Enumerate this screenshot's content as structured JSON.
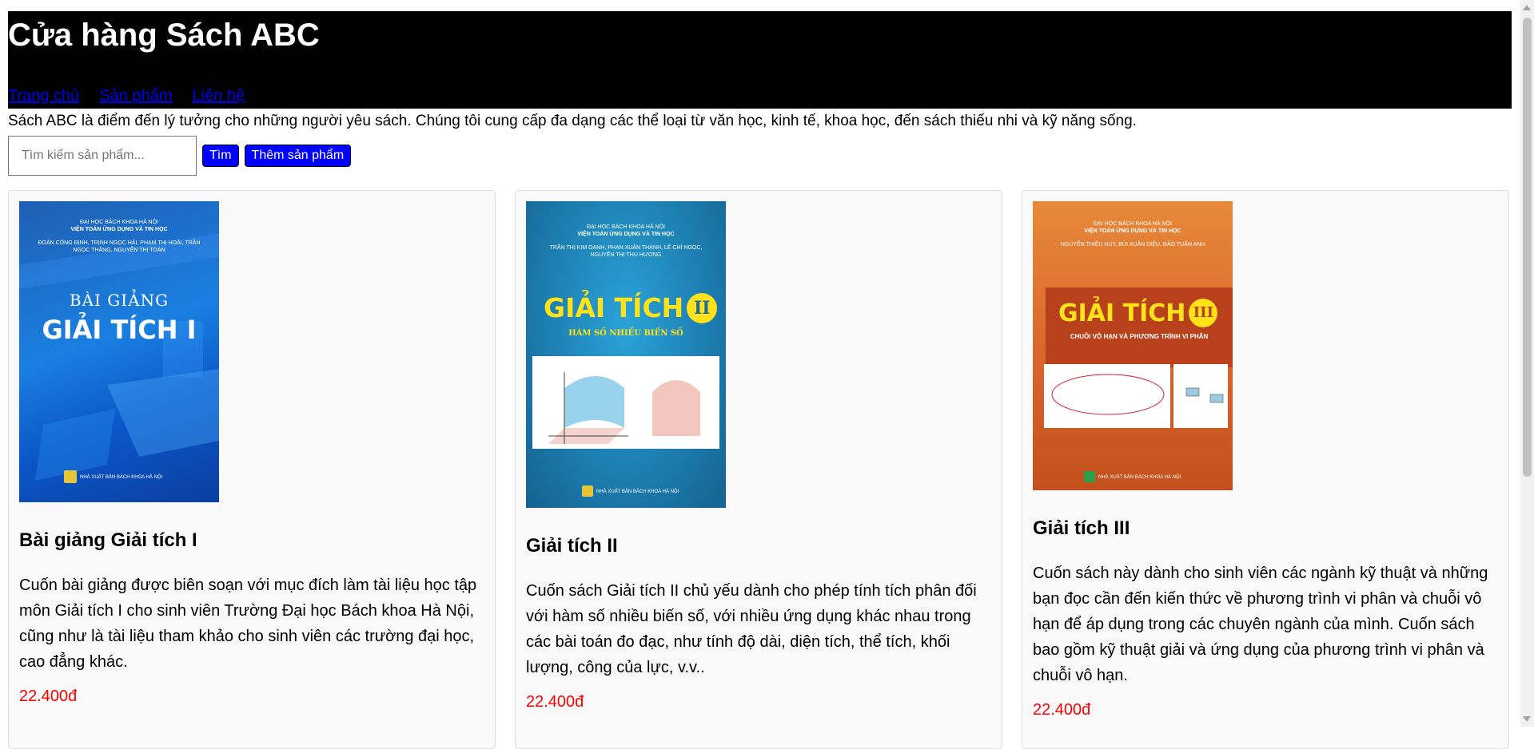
{
  "site": {
    "title": "Cửa hàng Sách ABC",
    "nav": [
      "Trang chủ",
      "Sản phẩm",
      "Liên hệ"
    ],
    "intro": "Sách ABC là điểm đến lý tưởng cho những người yêu sách. Chúng tôi cung cấp đa dạng các thể loại từ văn học, kinh tế, khoa học, đến sách thiếu nhi và kỹ năng sống."
  },
  "search": {
    "placeholder": "Tìm kiếm sản phẩm...",
    "search_label": "Tìm",
    "add_label": "Thêm sản phẩm"
  },
  "products": [
    {
      "title": "Bài giảng Giải tích I",
      "description": "Cuốn bài giảng được biên soạn với mục đích làm tài liệu học tập môn Giải tích I cho sinh viên Trường Đại học Bách khoa Hà Nội, cũng như là tài liệu tham khảo cho sinh viên các trường đại học, cao đẳng khác.",
      "price": "22.400đ",
      "cover": {
        "top1": "ĐẠI HỌC BÁCH KHOA HÀ NỘI",
        "top2": "VIỆN TOÁN ỨNG DỤNG VÀ TIN HỌC",
        "authors": "ĐOÀN CÔNG ĐỊNH, TRỊNH NGỌC HẢI, PHẠM THỊ HOÀI, TRẦN NGỌC THĂNG, NGUYỄN THỊ TOÀN",
        "line1": "BÀI GIẢNG",
        "line2": "GIẢI TÍCH I",
        "publisher": "NHÀ XUẤT BẢN BÁCH KHOA HÀ NỘI"
      }
    },
    {
      "title": "Giải tích II",
      "description": "Cuốn sách Giải tích II chủ yếu dành cho phép tính tích phân đối với hàm số nhiều biến số, với nhiều ứng dụng khác nhau trong các bài toán đo đạc, như tính độ dài, diện tích, thể tích, khối lượng, công của lực, v.v..",
      "price": "22.400đ",
      "cover": {
        "top1": "ĐẠI HỌC BÁCH KHOA HÀ NỘI",
        "top2": "VIỆN TOÁN ỨNG DỤNG VÀ TIN HỌC",
        "authors": "TRẦN THỊ KIM OANH, PHAN XUÂN THÀNH, LÊ CHÍ NGỌC, NGUYỄN THỊ THU HƯƠNG",
        "line1": "GIẢI TÍCH",
        "numeral": "II",
        "subtitle": "HÀM SỐ NHIỀU BIẾN SỐ",
        "publisher": "NHÀ XUẤT BẢN BÁCH KHOA HÀ NỘI"
      }
    },
    {
      "title": "Giải tích III",
      "description": "Cuốn sách này dành cho sinh viên các ngành kỹ thuật và những bạn đọc cần đến kiến thức về phương trình vi phân và chuỗi vô hạn để áp dụng trong các chuyên ngành của mình. Cuốn sách bao gồm kỹ thuật giải và ứng dụng của phương trình vi phân và chuỗi vô hạn.",
      "price": "22.400đ",
      "cover": {
        "top1": "ĐẠI HỌC BÁCH KHOA HÀ NỘI",
        "top2": "VIỆN TOÁN ỨNG DỤNG VÀ TIN HỌC",
        "authors": "NGUYỄN THIỆU HUY, BÙI XUÂN DIỆU, ĐÀO TUẤN ANH",
        "line1": "GIẢI TÍCH",
        "numeral": "III",
        "subtitle": "CHUỖI VÔ HẠN VÀ PHƯƠNG TRÌNH VI PHÂN",
        "publisher": "NHÀ XUẤT BẢN BÁCH KHOA HÀ NỘI"
      }
    }
  ],
  "colors": {
    "header_bg": "#000000",
    "link": "#0000ee",
    "button_bg": "#0000ff",
    "price": "#ff0000",
    "card_bg": "#f9f9f9"
  }
}
